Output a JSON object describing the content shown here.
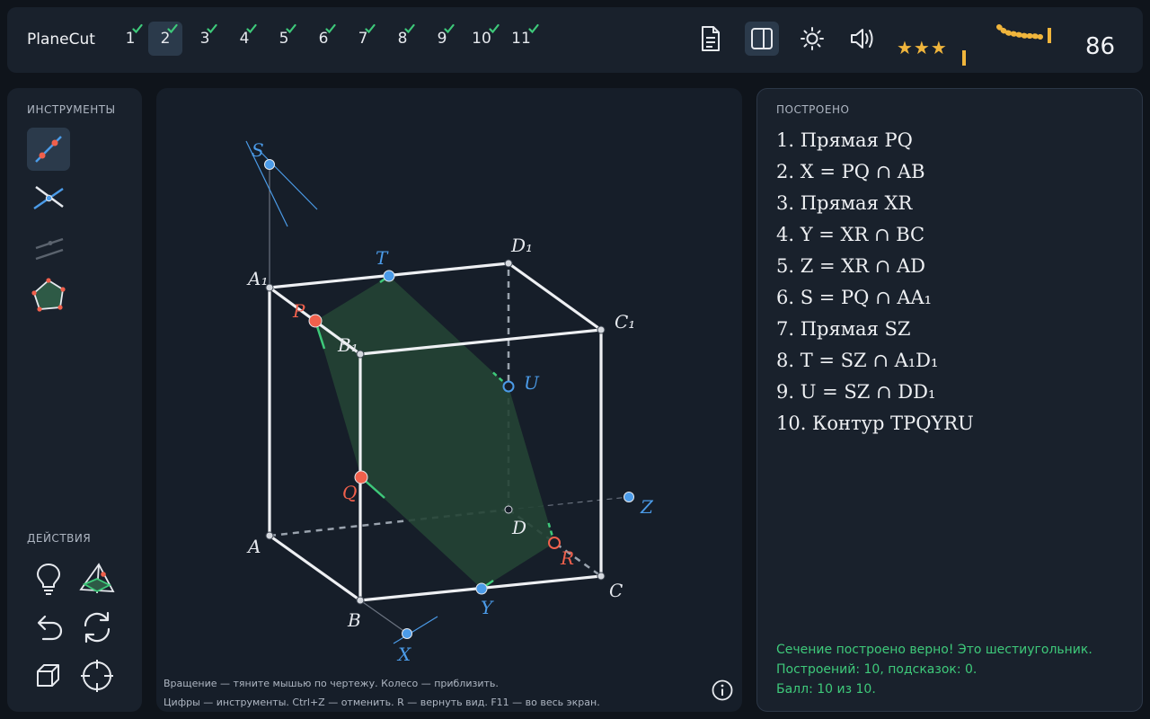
{
  "app": {
    "title": "PlaneCut"
  },
  "levels": [
    {
      "label": "1",
      "done": true,
      "active": false
    },
    {
      "label": "2",
      "done": true,
      "active": true
    },
    {
      "label": "3",
      "done": true,
      "active": false
    },
    {
      "label": "4",
      "done": true,
      "active": false
    },
    {
      "label": "5",
      "done": true,
      "active": false
    },
    {
      "label": "6",
      "done": true,
      "active": false
    },
    {
      "label": "7",
      "done": true,
      "active": false
    },
    {
      "label": "8",
      "done": true,
      "active": false
    },
    {
      "label": "9",
      "done": true,
      "active": false
    },
    {
      "label": "10",
      "done": true,
      "active": false
    },
    {
      "label": "11",
      "done": true,
      "active": false
    }
  ],
  "toolbar": {
    "buttons": [
      {
        "icon": "document-icon",
        "active": false
      },
      {
        "icon": "sidebar-panel-icon",
        "active": true
      },
      {
        "icon": "brightness-icon",
        "active": false
      },
      {
        "icon": "volume-icon",
        "active": false
      }
    ],
    "stars": "★★★",
    "score": "86"
  },
  "tools": {
    "title": "ИНСТРУМЕНТЫ",
    "items": [
      {
        "icon": "line-tool-icon",
        "active": true,
        "enabled": true
      },
      {
        "icon": "intersection-tool-icon",
        "active": false,
        "enabled": true
      },
      {
        "icon": "parallel-tool-icon",
        "active": false,
        "enabled": false
      },
      {
        "icon": "polygon-tool-icon",
        "active": false,
        "enabled": true
      }
    ]
  },
  "actions": {
    "title": "ДЕЙСТВИЯ",
    "items": [
      {
        "icon": "lightbulb-icon"
      },
      {
        "icon": "show-section-icon"
      },
      {
        "icon": "undo-icon"
      },
      {
        "icon": "reset-icon"
      },
      {
        "icon": "cube-view-icon"
      },
      {
        "icon": "center-view-icon"
      }
    ]
  },
  "canvas": {
    "hint_line1": "Вращение — тяните мышью по чертежу.  Колесо — приблизить.",
    "hint_line2": "Цифры — инструменты.  Ctrl+Z — отменить.  R — вернуть вид.  F11 — во весь экран.",
    "labels": {
      "A": "A",
      "B": "B",
      "C": "C",
      "D": "D",
      "A1": "A₁",
      "B1": "B₁",
      "C1": "C₁",
      "D1": "D₁",
      "P": "P",
      "Q": "Q",
      "R": "R",
      "S": "S",
      "T": "T",
      "U": "U",
      "X": "X",
      "Y": "Y",
      "Z": "Z"
    }
  },
  "log": {
    "title": "ПОСТРОЕНО",
    "steps": [
      "1. Прямая PQ",
      "2. X = PQ ∩ AB",
      "3. Прямая XR",
      "4. Y = XR ∩ BC",
      "5. Z = XR ∩ AD",
      "6. S = PQ ∩ AA₁",
      "7. Прямая SZ",
      "8. T = SZ ∩ A₁D₁",
      "9. U = SZ ∩ DD₁",
      "10. Контур TPQYRU"
    ],
    "status1": "Сечение построено верно! Это шестиугольник.",
    "status2": "Построений: 10, подсказок: 0.",
    "status3": "Балл: 10 из 10."
  },
  "colors": {
    "accent": "#4b9be8",
    "given_point": "#f0604c",
    "section_fill": "#234234",
    "success": "#3ec97a",
    "star": "#f0b53c"
  }
}
